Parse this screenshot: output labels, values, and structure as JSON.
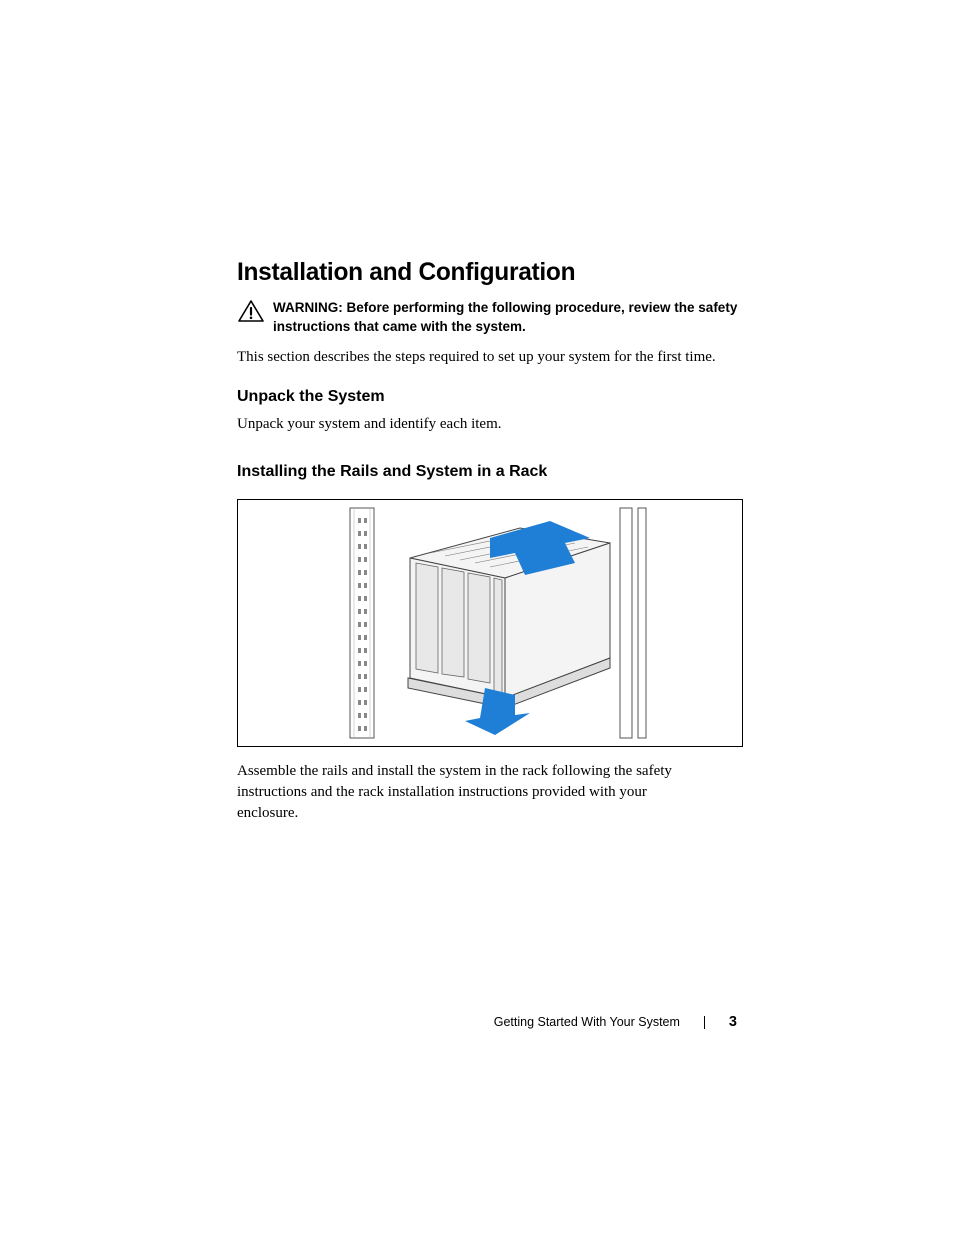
{
  "heading": "Installation and Configuration",
  "warning": {
    "label": "WARNING:",
    "body": " Before performing the following procedure, review the safety instructions that came with the system."
  },
  "intro": "This section describes the steps required to set up your system for the first time.",
  "section1": {
    "heading": "Unpack the System",
    "body": "Unpack your system and identify each item."
  },
  "section2": {
    "heading": "Installing the Rails and System in a Rack",
    "body": "Assemble the rails and install the system in the rack following the safety instructions and the rack installation instructions provided with your enclosure."
  },
  "figure": {
    "alt": "rack-installation-illustration"
  },
  "footer": {
    "section_title": "Getting Started With Your System",
    "page_number": "3"
  }
}
